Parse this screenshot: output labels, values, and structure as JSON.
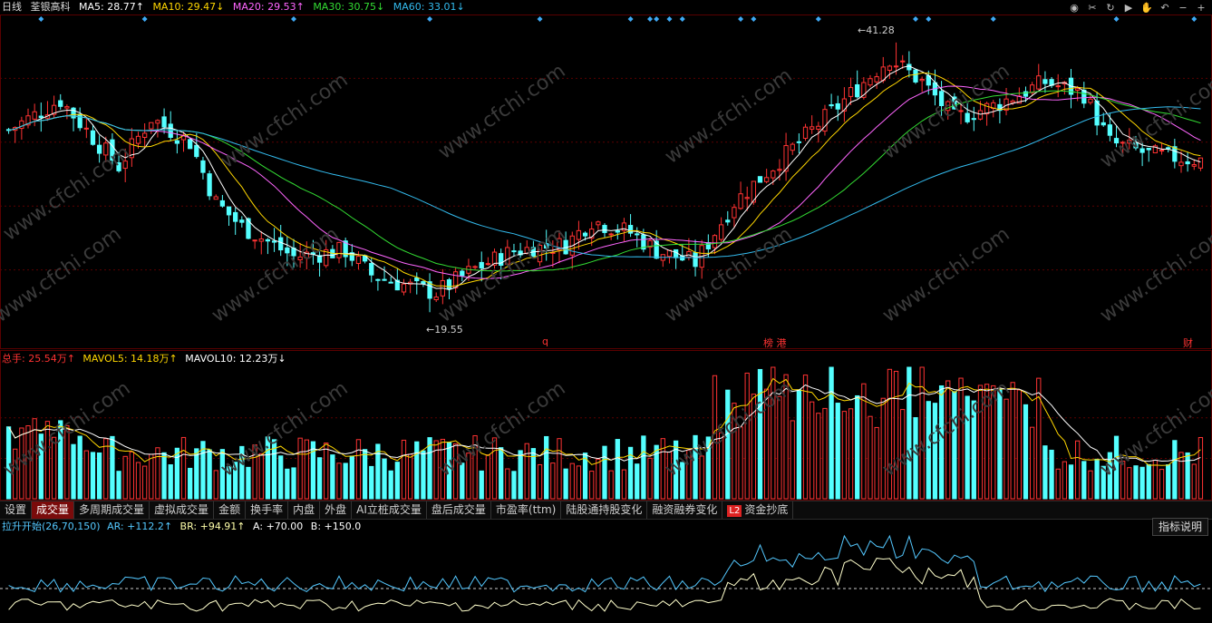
{
  "main_legend": {
    "period": "日线",
    "stock_name": "荃银高科",
    "ma5": "MA5: 28.77↑",
    "ma10": "MA10: 29.47↓",
    "ma20": "MA20: 29.53↑",
    "ma30": "MA30: 30.75↓",
    "ma60": "MA60: 33.01↓"
  },
  "colors": {
    "ma5": "#ffffff",
    "ma10": "#ffd700",
    "ma20": "#ff66ff",
    "ma30": "#33dd33",
    "ma60": "#33bbee",
    "up": "#ff3333",
    "down": "#54ffff",
    "grid": "#5a0000"
  },
  "toolbar_icons": [
    "eye-icon",
    "scissors-icon",
    "refresh-icon",
    "play-icon",
    "hand-icon",
    "undo-icon",
    "minus-icon",
    "plus-icon"
  ],
  "annotations": {
    "high": "41.28",
    "low": "19.55",
    "event1": "q",
    "event2": "榜 港",
    "event3": "财"
  },
  "volume_legend": {
    "total": "总手: 25.54万↑",
    "mavol5": "MAVOL5: 14.18万↑",
    "mavol10": "MAVOL10: 12.23万↓"
  },
  "tabs": [
    {
      "label": "设置"
    },
    {
      "label": "成交量"
    },
    {
      "label": "多周期成交量"
    },
    {
      "label": "虚拟成交量"
    },
    {
      "label": "金额"
    },
    {
      "label": "换手率"
    },
    {
      "label": "内盘"
    },
    {
      "label": "外盘"
    },
    {
      "label": "AI立桩成交量"
    },
    {
      "label": "盘后成交量"
    },
    {
      "label": "市盈率(ttm)"
    },
    {
      "label": "陆股通持股变化"
    },
    {
      "label": "融资融券变化"
    },
    {
      "label": "资金抄底",
      "badge": "L2"
    }
  ],
  "indicator_legend": {
    "name": "拉升开始(26,70,150)",
    "ar": "AR: +112.2↑",
    "br": "BR: +94.91↑",
    "a": "A: +70.00",
    "b": "B: +150.0"
  },
  "indicator_button": "指标说明",
  "watermark": "www.cfchi.com",
  "chart_data": {
    "type": "candlestick",
    "price_range": [
      18,
      43
    ],
    "high": 41.28,
    "low": 19.55,
    "series": [
      {
        "name": "MA5",
        "last": 28.77
      },
      {
        "name": "MA10",
        "last": 29.47
      },
      {
        "name": "MA20",
        "last": 29.53
      },
      {
        "name": "MA30",
        "last": 30.75
      },
      {
        "name": "MA60",
        "last": 33.01
      }
    ],
    "volume": {
      "total": "25.54万",
      "mavol5": "14.18万",
      "mavol10": "12.23万"
    },
    "indicator": {
      "AR": 112.2,
      "BR": 94.91,
      "A": 70,
      "B": 150
    }
  }
}
